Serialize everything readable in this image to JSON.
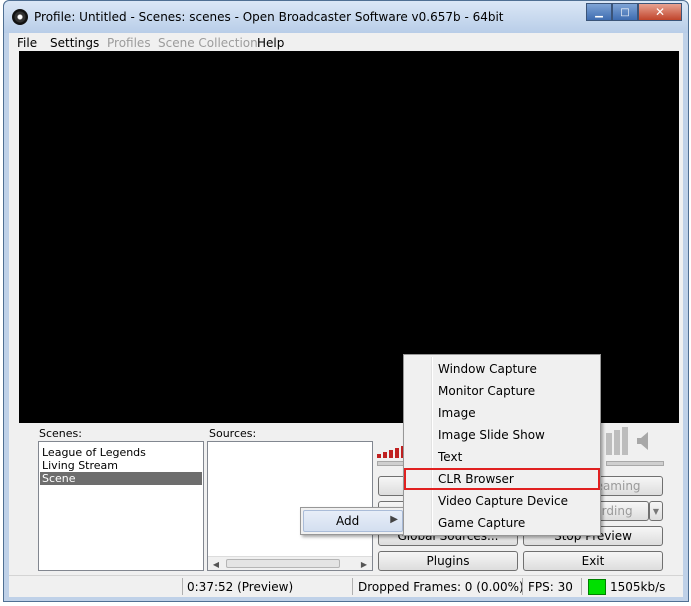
{
  "window": {
    "title": "Profile: Untitled - Scenes: scenes - Open Broadcaster Software v0.657b - 64bit",
    "icons": {
      "app": "obs-logo-icon",
      "minimize": "minimize-icon",
      "maximize": "maximize-icon",
      "close": "close-icon"
    },
    "min_glyph": "▁",
    "max_glyph": "□",
    "close_glyph": "✕"
  },
  "menubar": {
    "items": [
      {
        "label": "File",
        "enabled": true
      },
      {
        "label": "Settings",
        "enabled": true
      },
      {
        "label": "Profiles",
        "enabled": false
      },
      {
        "label": "Scene Collection",
        "enabled": false
      },
      {
        "label": "Help",
        "enabled": true
      }
    ]
  },
  "scenes": {
    "label": "Scenes:",
    "items": [
      "League of Legends",
      "Living Stream",
      "Scene"
    ],
    "selected": "Scene"
  },
  "sources": {
    "label": "Sources:",
    "items": [],
    "scroll_left": "◀",
    "scroll_right": "▶"
  },
  "buttons": {
    "start_streaming": "Start Streaming",
    "start_recording": "Start Recording",
    "global_sources": "Global Sources...",
    "stop_preview": "Stop Preview",
    "plugins": "Plugins",
    "exit": "Exit",
    "dropdown_arrow": "▼"
  },
  "audio": {
    "icons": {
      "mic_meter": "mic-meter-icon",
      "speaker": "speaker-icon"
    },
    "meter_color": "#c02020"
  },
  "status": {
    "time": "0:37:52 (Preview)",
    "dropped_frames": "Dropped Frames: 0 (0.00%)",
    "fps": "FPS: 30",
    "bitrate": "1505kb/s",
    "bitrate_color": "#00e000"
  },
  "context_menu_add": {
    "label": "Add",
    "arrow": "▶"
  },
  "context_submenu": {
    "items": [
      "Window Capture",
      "Monitor Capture",
      "Image",
      "Image Slide Show",
      "Text",
      "CLR Browser",
      "Video Capture Device",
      "Game Capture"
    ],
    "highlighted": "CLR Browser",
    "highlight_color": "#e02020"
  }
}
